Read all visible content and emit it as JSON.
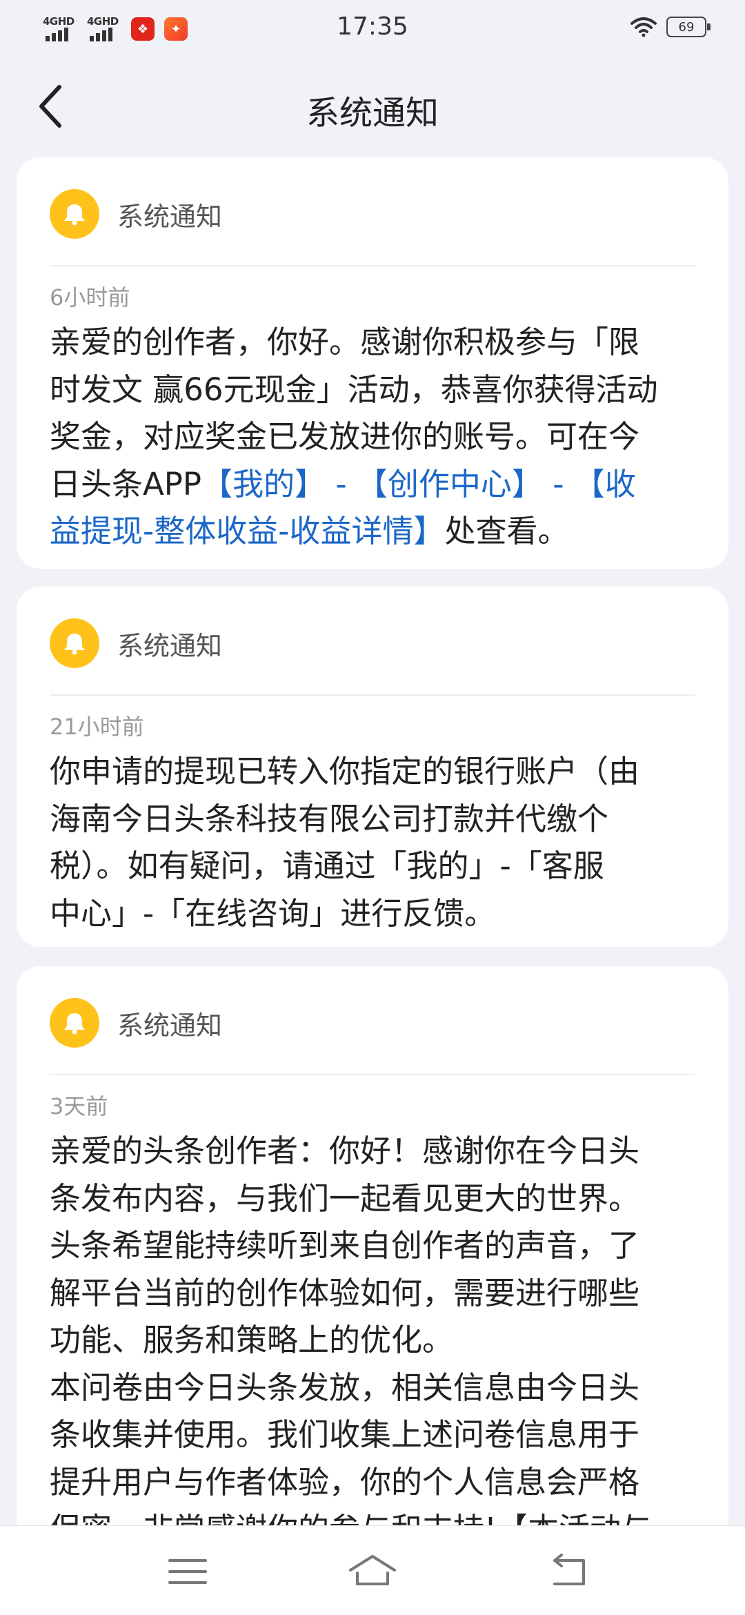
{
  "status_bar": {
    "time": "17:35",
    "network1": "4GHD",
    "network2": "4GHD",
    "battery": "69",
    "icons": [
      "signal-icon",
      "signal-icon",
      "app-notification-icon",
      "app-notification-icon",
      "wifi-icon",
      "battery-icon"
    ]
  },
  "header": {
    "title": "系统通知",
    "back_icon": "chevron-left-icon"
  },
  "notifications": [
    {
      "label": "系统通知",
      "time": "6小时前",
      "icon": "bell-icon",
      "lines": [
        "亲爱的创作者，你好。感谢你积极参与「限",
        "时发文 赢66元现金」活动，恭喜你获得活动",
        "奖金，对应奖金已发放进你的账号。可在今",
        "日头条APP",
        "【我的】 - 【创作中心】 - 【收",
        "益提现-整体收益-收益详情】",
        "处查看。"
      ]
    },
    {
      "label": "系统通知",
      "time": "21小时前",
      "icon": "bell-icon",
      "lines": [
        "你申请的提现已转入你指定的银行账户（由",
        "海南今日头条科技有限公司打款并代缴个",
        "税）。如有疑问，请通过「我的」-「客服",
        "中心」-「在线咨询」进行反馈。"
      ]
    },
    {
      "label": "系统通知",
      "time": "3天前",
      "icon": "bell-icon",
      "lines": [
        "亲爱的头条创作者：你好！感谢你在今日头",
        "条发布内容，与我们一起看见更大的世界。",
        "头条希望能持续听到来自创作者的声音，了",
        "解平台当前的创作体验如何，需要进行哪些",
        "功能、服务和策略上的优化。",
        "本问卷由今日头条发放，相关信息由今日头",
        "条收集并使用。我们收集上述问卷信息用于",
        "提升用户与作者体验，你的个人信息会严格",
        "保密，非常感谢你的参与和支持!【本活动与"
      ]
    }
  ],
  "bottom_nav": {
    "icons": [
      "menu-icon",
      "home-icon",
      "back-nav-icon"
    ]
  },
  "colors": {
    "background": "#f0f2f7",
    "card": "#ffffff",
    "bell": "#ffc21a",
    "link": "#1b67c8",
    "text": "#222222",
    "muted": "#999999"
  }
}
